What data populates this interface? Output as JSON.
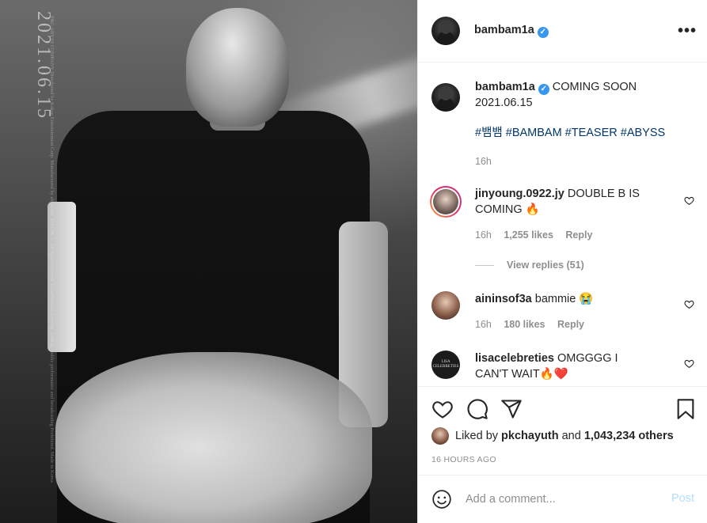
{
  "photo": {
    "vertical_date": "2021.06.15",
    "fine_print": "P&C ABYSS COMPANY Distributed by Kakao Entertainment Corp. Manufactured by abyss Inc. 2021.06 — All rights reserved. Unauthorized copying, lending, public performance and broadcasting Prohibited. Made in Korea"
  },
  "post_header": {
    "username": "bambam1a",
    "verified_mark": "✓",
    "more_icon": "more-options-icon",
    "more_glyph": "•••"
  },
  "caption": {
    "username": "bambam1a",
    "verified_mark": "✓",
    "text": "COMING SOON",
    "date_line": "2021.06.15",
    "hashtags": [
      "#뱀뱀",
      "#BAMBAM",
      "#TEASER",
      "#ABYSS"
    ],
    "time": "16h"
  },
  "comments": [
    {
      "username": "jinyoung.0922.jy",
      "text": "DOUBLE B IS COMING 🔥",
      "time": "16h",
      "likes": "1,255 likes",
      "reply": "Reply"
    },
    {
      "username": "aininsof3a",
      "text": "bammie 😭",
      "time": "16h",
      "likes": "180 likes",
      "reply": "Reply"
    },
    {
      "username": "lisacelebreties",
      "text": "OMGGGG I CAN'T WAIT🔥❤️"
    }
  ],
  "view_replies": "View replies (51)",
  "liked_by": {
    "prefix": "Liked by",
    "user": "pkchayuth",
    "conjunction": "and",
    "others": "1,043,234 others"
  },
  "timestamp": "16 HOURS AGO",
  "add_comment": {
    "placeholder": "Add a comment...",
    "post_label": "Post"
  },
  "logo_avatar_text": "LISA CELEBRETIES",
  "colors": {
    "link": "#00376b",
    "verified": "#3897f0",
    "muted": "#8e8e8e",
    "post_disabled": "#b2dffc"
  }
}
